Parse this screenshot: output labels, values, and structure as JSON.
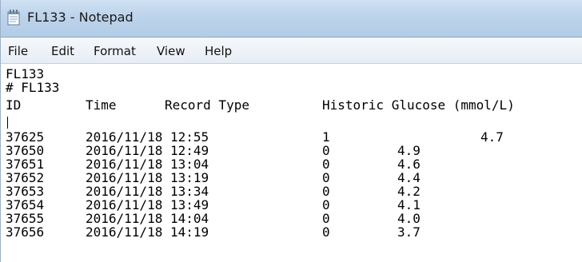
{
  "window": {
    "title": "FL133 - Notepad",
    "icon": "notepad-icon"
  },
  "menu": {
    "file": "File",
    "edit": "Edit",
    "format": "Format",
    "view": "View",
    "help": "Help"
  },
  "document": {
    "line1": "FL133",
    "line2": "# FL133",
    "headers": {
      "id": "ID",
      "time": "Time",
      "record_type": "Record Type",
      "glucose": "Historic Glucose (mmol/L)"
    },
    "rows": [
      {
        "id": "37625",
        "time": "2016/11/18 12:55",
        "type": "1",
        "glucose": "4.7"
      },
      {
        "id": "37650",
        "time": "2016/11/18 12:49",
        "type": "0",
        "glucose": "4.9"
      },
      {
        "id": "37651",
        "time": "2016/11/18 13:04",
        "type": "0",
        "glucose": "4.6"
      },
      {
        "id": "37652",
        "time": "2016/11/18 13:19",
        "type": "0",
        "glucose": "4.4"
      },
      {
        "id": "37653",
        "time": "2016/11/18 13:34",
        "type": "0",
        "glucose": "4.2"
      },
      {
        "id": "37654",
        "time": "2016/11/18 13:49",
        "type": "0",
        "glucose": "4.1"
      },
      {
        "id": "37655",
        "time": "2016/11/18 14:04",
        "type": "0",
        "glucose": "4.0"
      },
      {
        "id": "37656",
        "time": "2016/11/18 14:19",
        "type": "0",
        "glucose": "3.7"
      }
    ]
  }
}
